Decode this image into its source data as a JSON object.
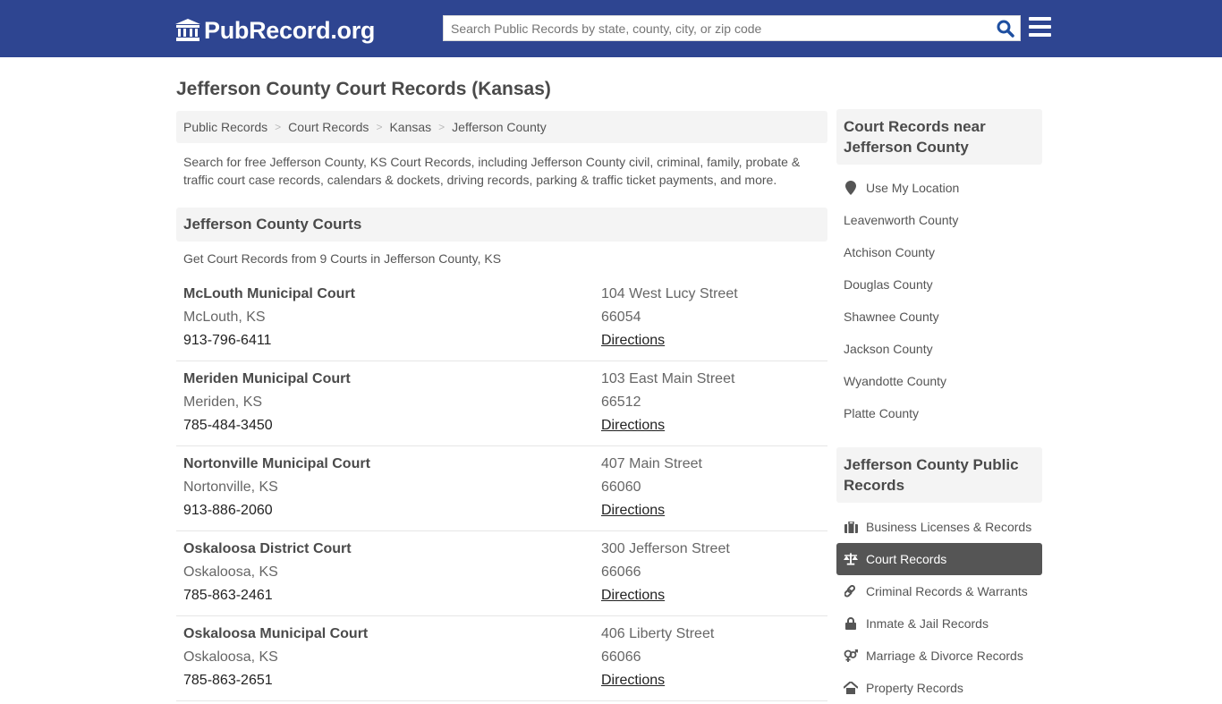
{
  "header": {
    "logo_text": "PubRecord.org",
    "search_placeholder": "Search Public Records by state, county, city, or zip code"
  },
  "page": {
    "title": "Jefferson County Court Records (Kansas)",
    "breadcrumb": [
      "Public Records",
      "Court Records",
      "Kansas",
      "Jefferson County"
    ],
    "intro": "Search for free Jefferson County, KS Court Records, including Jefferson County civil, criminal, family, probate & traffic court case records, calendars & dockets, driving records, parking & traffic ticket payments, and more."
  },
  "courts": {
    "heading": "Jefferson County Courts",
    "subtitle": "Get Court Records from 9 Courts in Jefferson County, KS",
    "directions_label": "Directions",
    "items": [
      {
        "name": "McLouth Municipal Court",
        "city": "McLouth, KS",
        "phone": "913-796-6411",
        "address": "104 West Lucy Street",
        "zip": "66054"
      },
      {
        "name": "Meriden Municipal Court",
        "city": "Meriden, KS",
        "phone": "785-484-3450",
        "address": "103 East Main Street",
        "zip": "66512"
      },
      {
        "name": "Nortonville Municipal Court",
        "city": "Nortonville, KS",
        "phone": "913-886-2060",
        "address": "407 Main Street",
        "zip": "66060"
      },
      {
        "name": "Oskaloosa District Court",
        "city": "Oskaloosa, KS",
        "phone": "785-863-2461",
        "address": "300 Jefferson Street",
        "zip": "66066"
      },
      {
        "name": "Oskaloosa Municipal Court",
        "city": "Oskaloosa, KS",
        "phone": "785-863-2651",
        "address": "406 Liberty Street",
        "zip": "66066"
      }
    ]
  },
  "sidebar": {
    "nearby": {
      "heading": "Court Records near Jefferson County",
      "use_location": "Use My Location",
      "counties": [
        "Leavenworth County",
        "Atchison County",
        "Douglas County",
        "Shawnee County",
        "Jackson County",
        "Wyandotte County",
        "Platte County"
      ]
    },
    "public_records": {
      "heading": "Jefferson County Public Records",
      "items": [
        {
          "label": "Business Licenses & Records",
          "icon": "briefcase-icon",
          "active": false
        },
        {
          "label": "Court Records",
          "icon": "scale-icon",
          "active": true
        },
        {
          "label": "Criminal Records & Warrants",
          "icon": "link-icon",
          "active": false
        },
        {
          "label": "Inmate & Jail Records",
          "icon": "lock-icon",
          "active": false
        },
        {
          "label": "Marriage & Divorce Records",
          "icon": "marriage-icon",
          "active": false
        },
        {
          "label": "Property Records",
          "icon": "home-icon",
          "active": false
        }
      ]
    }
  },
  "colors": {
    "header_bg": "#2e4591",
    "search_icon": "#1e4fa0",
    "active_item_bg": "#555555"
  }
}
